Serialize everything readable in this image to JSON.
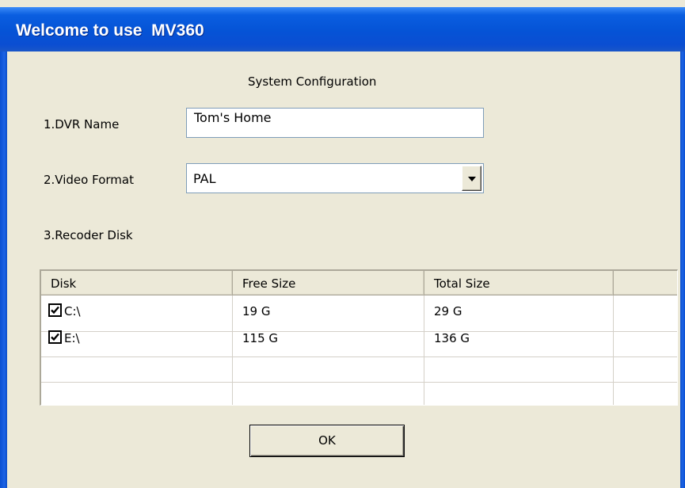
{
  "window": {
    "title": "Welcome to use  MV360"
  },
  "dialog": {
    "heading": "System Configuration",
    "dvr_name": {
      "label": "1.DVR Name",
      "value": "Tom's Home"
    },
    "video_format": {
      "label": "2.Video Format",
      "selected": "PAL"
    },
    "recorder_disk": {
      "label": "3.Recoder Disk"
    },
    "disk_table": {
      "columns": [
        "Disk",
        "Free Size",
        "Total Size",
        ""
      ],
      "rows": [
        {
          "checked": true,
          "disk": "C:\\",
          "free": "19 G",
          "total": "29 G"
        },
        {
          "checked": true,
          "disk": "E:\\",
          "free": "115 G",
          "total": "136 G"
        }
      ]
    },
    "ok_label": "OK"
  },
  "icons": {
    "dropdown": "chevron-down-icon",
    "checkbox": "checkbox-checked-icon"
  }
}
